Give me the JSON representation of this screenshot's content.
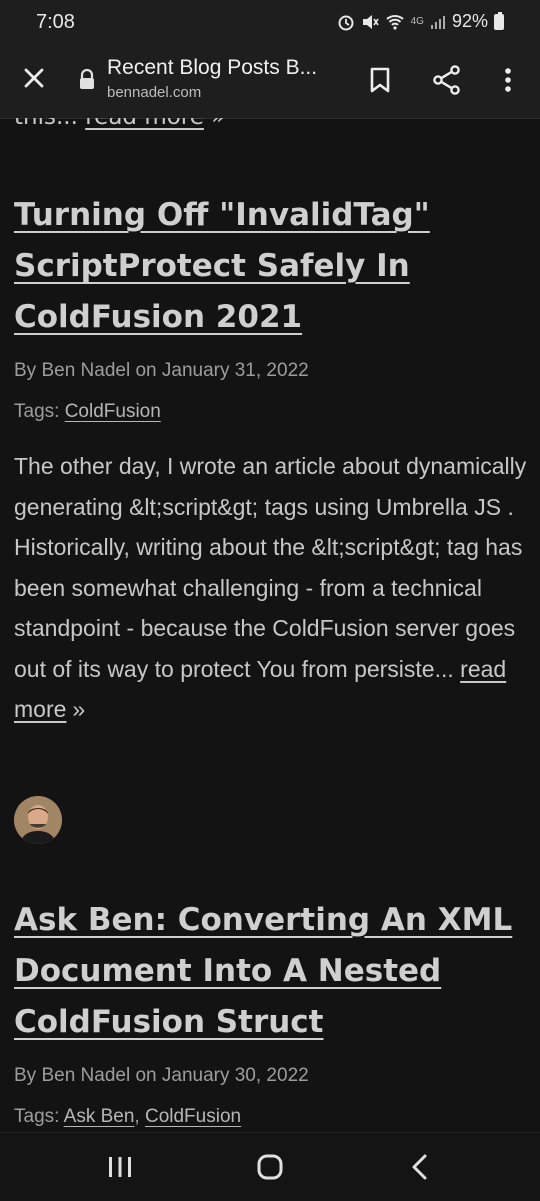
{
  "status_bar": {
    "time": "7:08",
    "network": "4G",
    "battery": "92%"
  },
  "toolbar": {
    "title": "Recent Blog Posts B...",
    "url": "bennadel.com"
  },
  "top_fragment": {
    "text": "this...",
    "link": "read more",
    "suffix": "»"
  },
  "posts": [
    {
      "title": "Turning Off \"InvalidTag\" ScriptProtect Safely In ColdFusion 2021",
      "byline": "By Ben Nadel on January 31, 2022",
      "tags_label": "Tags:",
      "tags": [
        "ColdFusion"
      ],
      "excerpt": "The other day, I wrote an article about dynamically generating &lt;script&gt; tags using Umbrella JS . Historically, writing about the &lt;script&gt; tag has been somewhat challenging - from a technical standpoint - because the ColdFusion server goes out of its way to protect You from persiste...",
      "read_more": "read more",
      "suffix": "»"
    },
    {
      "title": "Ask Ben: Converting An XML Document Into A Nested ColdFusion Struct",
      "byline": "By Ben Nadel on January 30, 2022",
      "tags_label": "Tags:",
      "tags": [
        "Ask Ben",
        "ColdFusion"
      ]
    }
  ],
  "icons": {
    "close": "close-icon",
    "lock": "lock-icon",
    "bookmark": "bookmark-icon",
    "share": "share-icon",
    "more": "more-vert-icon",
    "recents": "recents-icon",
    "home": "home-icon",
    "back": "back-icon"
  },
  "colors": {
    "background": "#131313",
    "toolbar": "#1e1e1e",
    "text": "#c9c9c9"
  }
}
